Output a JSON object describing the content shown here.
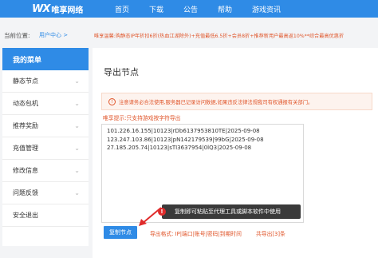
{
  "brand": {
    "logo_mark": "WX",
    "logo_text": "唯享网络"
  },
  "nav": {
    "home": "首页",
    "download": "下载",
    "notice": "公告",
    "help": "帮助",
    "game_news": "游戏资讯"
  },
  "location": {
    "label": "当前位置:",
    "link": "用户中心 >",
    "marquee": "唯享温馨:购静态IP年折扣6折(热血江湖除外)+充值最低6.5折+会员8折+推荐新用户最高返10%**综合最高优惠折"
  },
  "sidebar": {
    "header": "我的菜单",
    "items": [
      {
        "label": "静态节点"
      },
      {
        "label": "动态包机"
      },
      {
        "label": "推荐奖励"
      },
      {
        "label": "充值管理"
      },
      {
        "label": "修改信息"
      },
      {
        "label": "问题反馈"
      },
      {
        "label": "安全退出"
      }
    ]
  },
  "main": {
    "title": "导出节点",
    "warning": "注意请务必合法使用,服务器已记录访问数据,如果违反法律法规我司有权通报有关部门。",
    "hint": "唯享提示:只支持游戏按字符导出",
    "nodes": [
      "101.226.16.155|10123|rDb6137953810TE|2025-09-08",
      "123.247.103.86|10123|pN142179539|99bG|2025-09-08",
      "27.185.205.74|10123|sTI3637954|0lQ3|2025-09-08"
    ],
    "tooltip": "复制即可粘贴至代理工具或脚本软件中使用",
    "badge": "!",
    "copy_button": "复制节点",
    "export_format": "导出格式: IP|端口|账号|密码|到期时间",
    "export_count": "共导出[3]条"
  },
  "colors": {
    "accent": "#2f8be6",
    "warning": "#e0562b",
    "tooltip_bg": "#3a3a3a",
    "badge": "#e02b2b"
  }
}
